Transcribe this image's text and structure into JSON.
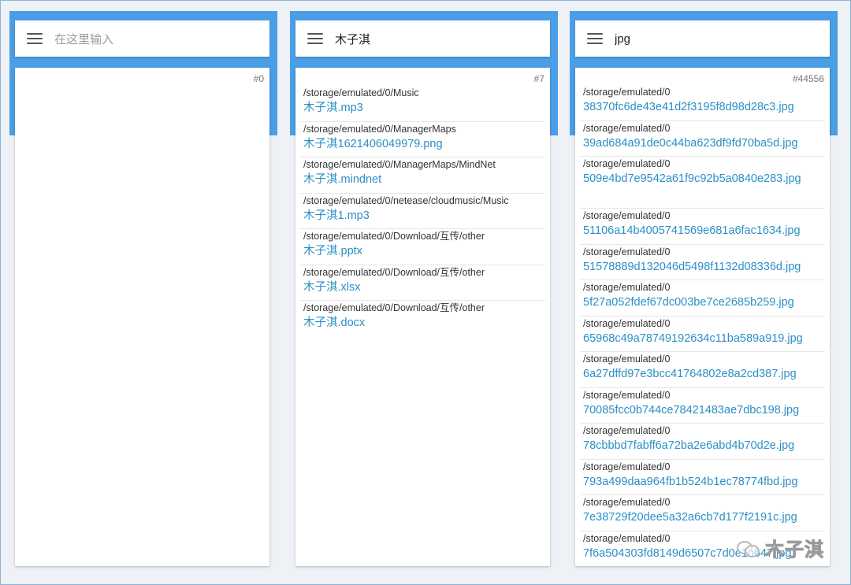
{
  "panels": [
    {
      "search_value": "",
      "search_placeholder": "在这里输入",
      "count": "#0",
      "results": []
    },
    {
      "search_value": "木子淇",
      "search_placeholder": "",
      "count": "#7",
      "results": [
        {
          "path": "/storage/emulated/0/Music",
          "name": "木子淇.mp3"
        },
        {
          "path": "/storage/emulated/0/ManagerMaps",
          "name": "木子淇1621406049979.png"
        },
        {
          "path": "/storage/emulated/0/ManagerMaps/MindNet",
          "name": "木子淇.mindnet"
        },
        {
          "path": "/storage/emulated/0/netease/cloudmusic/Music",
          "name": "木子淇1.mp3"
        },
        {
          "path": "/storage/emulated/0/Download/互传/other",
          "name": "木子淇.pptx"
        },
        {
          "path": "/storage/emulated/0/Download/互传/other",
          "name": "木子淇.xlsx"
        },
        {
          "path": "/storage/emulated/0/Download/互传/other",
          "name": "木子淇.docx"
        }
      ]
    },
    {
      "search_value": "jpg",
      "search_placeholder": "",
      "count": "#44556",
      "results": [
        {
          "path": "/storage/emulated/0",
          "name": "38370fc6de43e41d2f3195f8d98d28c3.jpg"
        },
        {
          "path": "/storage/emulated/0",
          "name": "39ad684a91de0c44ba623df9fd70ba5d.jpg"
        },
        {
          "path": "/storage/emulated/0",
          "name": "509e4bd7e9542a61f9c92b5a0840e283.jpg"
        },
        {
          "path": "/storage/emulated/0",
          "name": "51106a14b4005741569e681a6fac1634.jpg"
        },
        {
          "path": "/storage/emulated/0",
          "name": "51578889d132046d5498f1132d08336d.jpg"
        },
        {
          "path": "/storage/emulated/0",
          "name": "5f27a052fdef67dc003be7ce2685b259.jpg"
        },
        {
          "path": "/storage/emulated/0",
          "name": "65968c49a78749192634c11ba589a919.jpg"
        },
        {
          "path": "/storage/emulated/0",
          "name": "6a27dffd97e3bcc41764802e8a2cd387.jpg"
        },
        {
          "path": "/storage/emulated/0",
          "name": "70085fcc0b744ce78421483ae7dbc198.jpg"
        },
        {
          "path": "/storage/emulated/0",
          "name": "78cbbbd7fabff6a72ba2e6abd4b70d2e.jpg"
        },
        {
          "path": "/storage/emulated/0",
          "name": "793a499daa964fb1b524b1ec78774fbd.jpg"
        },
        {
          "path": "/storage/emulated/0",
          "name": "7e38729f20dee5a32a6cb7d177f2191c.jpg"
        },
        {
          "path": "/storage/emulated/0",
          "name": "7f6a504303fd8149d6507c7d0e1b647.jpg"
        }
      ]
    }
  ],
  "watermark": {
    "text": "木子淇",
    "icon": "wechat-icon"
  },
  "colors": {
    "accent_bar": "#4a9ee6",
    "file_name": "#2b8fc6",
    "background": "#eef1f5"
  }
}
